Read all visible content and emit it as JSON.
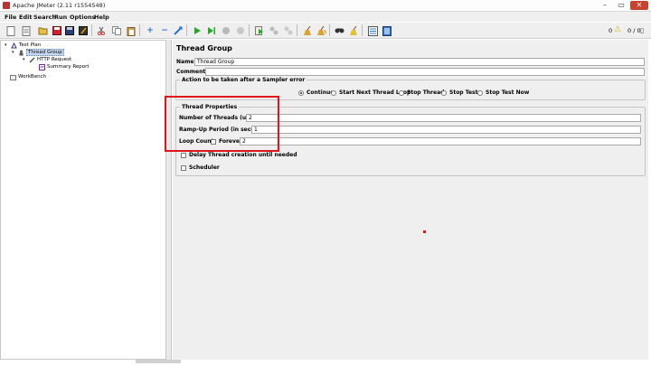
{
  "window": {
    "title": "Apache JMeter (2.11 r1554548)",
    "min_glyph": "–",
    "max_glyph": "▭",
    "close_glyph": "✕"
  },
  "menu": [
    "File",
    "Edit",
    "Search",
    "Run",
    "Options",
    "Help"
  ],
  "toolbar": {
    "buttons": [
      "new-icon",
      "templates-icon",
      "open-icon",
      "save-icon",
      "save-as-icon",
      "cut-icon",
      "copy-icon",
      "paste-icon",
      "expand-icon",
      "collapse-icon",
      "toggle-icon",
      "start-icon",
      "start-no-pause-icon",
      "stop-icon",
      "shutdown-icon",
      "remote-start-icon",
      "remote-stop-icon",
      "remote-shutdown-icon",
      "clear-icon",
      "clear-all-icon",
      "search-icon",
      "reset-search-icon",
      "function-helper-icon",
      "help-icon"
    ],
    "error_count": "0",
    "thread_count": "0 / 0"
  },
  "tree": {
    "nodes": [
      {
        "label": "Test Plan",
        "icon": "test-plan-icon"
      },
      {
        "label": "Thread Group",
        "icon": "thread-group-icon",
        "selected": true
      },
      {
        "label": "HTTP Request",
        "icon": "http-request-icon"
      },
      {
        "label": "Summary Report",
        "icon": "summary-report-icon"
      },
      {
        "label": "WorkBench",
        "icon": "workbench-icon"
      }
    ]
  },
  "editor": {
    "title": "Thread Group",
    "name_label": "Name:",
    "name_value": "Thread Group",
    "comments_label": "Comments:",
    "comments_value": "",
    "error_action": {
      "legend": "Action to be taken after a Sampler error",
      "options": [
        "Continue",
        "Start Next Thread Loop",
        "Stop Thread",
        "Stop Test",
        "Stop Test Now"
      ],
      "selected": "Continue"
    },
    "thread_props": {
      "legend": "Thread Properties",
      "num_threads_label": "Number of Threads (users):",
      "num_threads_value": "2",
      "ramp_up_label": "Ramp-Up Period (in seconds):",
      "ramp_up_value": "1",
      "loop_count_label": "Loop Count:",
      "forever_label": "Forever",
      "loop_count_value": "2"
    },
    "delay_label": "Delay Thread creation until needed",
    "scheduler_label": "Scheduler"
  }
}
